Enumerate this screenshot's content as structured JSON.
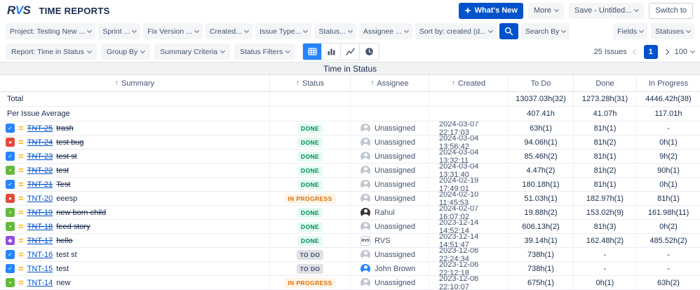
{
  "colors": {
    "accent_blue": "#0052CC",
    "view_selected": "#2684FF",
    "link_blue": "#0052CC",
    "priority_orange": "#FFAB00",
    "done_bg": "#E3FCEF",
    "done_text": "#00875A",
    "inprogress_bg": "#FFF4E6",
    "inprogress_text": "#D97008",
    "todo_bg": "#DFE1E6",
    "todo_text": "#42526E"
  },
  "header": {
    "logo": "RVS",
    "title": "TIME REPORTS",
    "whats_new": "What's New",
    "more": "More",
    "save": "Save - Untitled...",
    "switch_to": "Switch to"
  },
  "filter_bar": {
    "filters": [
      "Project: Testing New ...",
      "Sprint ...",
      "Fix Version ...",
      "Created...",
      "Issue Type...",
      "Status...",
      "Assignee ...",
      "Sort by: created (d..."
    ],
    "search_by": "Search By",
    "fields": "Fields",
    "statuses": "Statuses"
  },
  "report_bar": {
    "report": "Report: Time in Status",
    "group_by": "Group By",
    "summary_criteria": "Summary Criteria",
    "status_filters": "Status Filters",
    "issues_count": "25 Issues",
    "page": "1",
    "page_size": "100"
  },
  "icons": {
    "whats_new": "sparkle",
    "search": "magnifier",
    "views": [
      "table-view",
      "bar-chart-view",
      "line-chart-view",
      "time-view-clock"
    ],
    "priority_medium_glyph": "="
  },
  "issue_types": {
    "task": {
      "color": "#2684FF",
      "glyph": "✓"
    },
    "bug": {
      "color": "#E5493A",
      "glyph": "●"
    },
    "story": {
      "color": "#63BA3C",
      "glyph": "▪"
    },
    "epic": {
      "color": "#904EE2",
      "glyph": "◆"
    }
  },
  "table": {
    "band_title": "Time in Status",
    "columns": [
      "Summary",
      "Status",
      "Assignee",
      "Created",
      "To Do",
      "Done",
      "In Progress"
    ],
    "total_row": {
      "label": "Total",
      "todo": "13037.03h(32)",
      "done": "1273.28h(31)",
      "in_progress": "4446.42h(38)"
    },
    "average_row": {
      "label": "Per Issue Average",
      "todo": "407.41h",
      "done": "41.07h",
      "in_progress": "117.01h"
    },
    "rows": [
      {
        "key": "TNT-25",
        "summary": "trash",
        "type": "task",
        "resolved": true,
        "status": "DONE",
        "assignee": "Unassigned",
        "avatar": {
          "kind": "silhouette",
          "color": "#BFC7D2"
        },
        "created": "2024-03-07 22:17:03",
        "todo": "63h(1)",
        "done": "81h(1)",
        "in_progress": "-"
      },
      {
        "key": "TNT-24",
        "summary": "test bug",
        "type": "bug",
        "resolved": true,
        "status": "DONE",
        "assignee": "Unassigned",
        "avatar": {
          "kind": "silhouette",
          "color": "#BFC7D2"
        },
        "created": "2024-03-04 13:56:42",
        "todo": "94.06h(1)",
        "done": "81h(2)",
        "in_progress": "0h(1)"
      },
      {
        "key": "TNT-23",
        "summary": "test st",
        "type": "task",
        "resolved": true,
        "status": "DONE",
        "assignee": "Unassigned",
        "avatar": {
          "kind": "silhouette",
          "color": "#BFC7D2"
        },
        "created": "2024-03-04 13:32:11",
        "todo": "85.46h(2)",
        "done": "81h(1)",
        "in_progress": "9h(2)"
      },
      {
        "key": "TNT-22",
        "summary": "test",
        "type": "story",
        "resolved": true,
        "status": "DONE",
        "assignee": "Unassigned",
        "avatar": {
          "kind": "silhouette",
          "color": "#BFC7D2"
        },
        "created": "2024-03-04 13:31:40",
        "todo": "4.47h(2)",
        "done": "81h(2)",
        "in_progress": "90h(1)"
      },
      {
        "key": "TNT-21",
        "summary": "Test",
        "type": "task",
        "resolved": true,
        "status": "DONE",
        "assignee": "Unassigned",
        "avatar": {
          "kind": "silhouette",
          "color": "#BFC7D2"
        },
        "created": "2024-02-19 17:49:01",
        "todo": "180.18h(1)",
        "done": "81h(1)",
        "in_progress": "0h(1)"
      },
      {
        "key": "TNT-20",
        "summary": "eeesp",
        "type": "bug",
        "resolved": false,
        "status": "IN PROGRESS",
        "assignee": "Unassigned",
        "avatar": {
          "kind": "silhouette",
          "color": "#BFC7D2"
        },
        "created": "2024-02-10 11:45:53",
        "todo": "51.03h(1)",
        "done": "182.97h(1)",
        "in_progress": "81h(1)"
      },
      {
        "key": "TNT-19",
        "summary": "new born child",
        "type": "story",
        "resolved": true,
        "status": "DONE",
        "assignee": "Rahul",
        "avatar": {
          "kind": "silhouette",
          "color": "#3A3633"
        },
        "created": "2024-02-07 16:07:02",
        "todo": "19.88h(2)",
        "done": "153.02h(9)",
        "in_progress": "161.98h(11)"
      },
      {
        "key": "TNT-18",
        "summary": "feed story",
        "type": "story",
        "resolved": true,
        "status": "DONE",
        "assignee": "Unassigned",
        "avatar": {
          "kind": "silhouette",
          "color": "#BFC7D2"
        },
        "created": "2023-12-14 14:52:14",
        "todo": "606.13h(2)",
        "done": "81h(3)",
        "in_progress": "0h(2)"
      },
      {
        "key": "TNT-17",
        "summary": "hello",
        "type": "epic",
        "resolved": true,
        "status": "DONE",
        "assignee": "RVS",
        "avatar": {
          "kind": "logo",
          "label": "RVS"
        },
        "created": "2023-12-14 14:51:47",
        "todo": "39.14h(1)",
        "done": "162.48h(2)",
        "in_progress": "485.52h(2)"
      },
      {
        "key": "TNT-16",
        "summary": "test st",
        "type": "task",
        "resolved": false,
        "status": "TO DO",
        "assignee": "Unassigned",
        "avatar": {
          "kind": "silhouette",
          "color": "#BFC7D2"
        },
        "created": "2023-12-06 22:24:34",
        "todo": "738h(1)",
        "done": "-",
        "in_progress": "-"
      },
      {
        "key": "TNT-15",
        "summary": "test",
        "type": "task",
        "resolved": false,
        "status": "TO DO",
        "assignee": "John Brown",
        "avatar": {
          "kind": "silhouette",
          "color": "#2684FF"
        },
        "created": "2023-12-06 22:12:18",
        "todo": "738h(1)",
        "done": "-",
        "in_progress": "-"
      },
      {
        "key": "TNT-14",
        "summary": "new",
        "type": "story",
        "resolved": false,
        "status": "IN PROGRESS",
        "assignee": "Unassigned",
        "avatar": {
          "kind": "silhouette",
          "color": "#BFC7D2"
        },
        "created": "2023-12-06 22:10:07",
        "todo": "675h(1)",
        "done": "0h(1)",
        "in_progress": "63h(2)"
      }
    ]
  }
}
